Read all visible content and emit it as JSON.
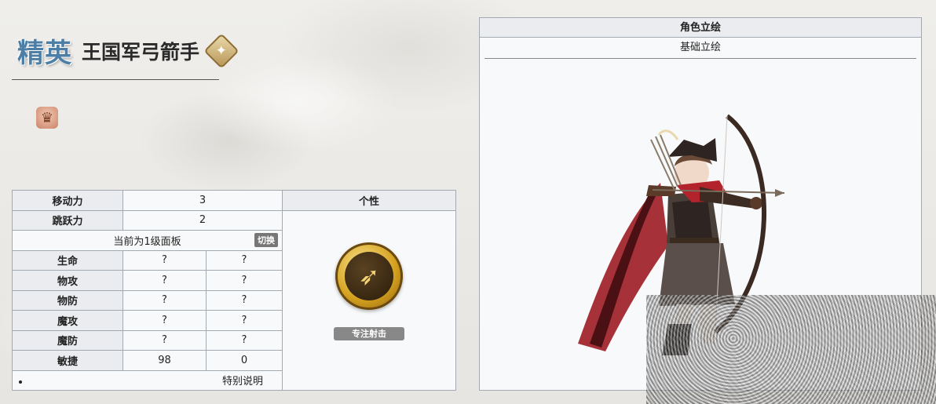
{
  "header": {
    "rank": "精英",
    "unit_name": "王国军弓箭手",
    "class_icon": "compass-emblem-icon",
    "crown_icon": "crown-icon"
  },
  "stats": {
    "move_label": "移动力",
    "move_value": "3",
    "jump_label": "跳跃力",
    "jump_value": "2",
    "trait_header": "个性",
    "panel_text": "当前为1级面板",
    "switch_label": "切换",
    "rows": [
      {
        "label": "生命",
        "a": "?",
        "b": "?"
      },
      {
        "label": "物攻",
        "a": "?",
        "b": "?"
      },
      {
        "label": "物防",
        "a": "?",
        "b": "?"
      },
      {
        "label": "魔攻",
        "a": "?",
        "b": "?"
      },
      {
        "label": "魔防",
        "a": "?",
        "b": "?"
      },
      {
        "label": "敏捷",
        "a": "98",
        "b": "0"
      }
    ],
    "trait_name": "专注射击",
    "trait_icon": "bow-arrow-icon",
    "note": "特别说明"
  },
  "portrait_panel": {
    "header": "角色立绘",
    "tab": "基础立绘"
  },
  "colors": {
    "table_header_bg": "#eaecf0",
    "table_border": "#a2a9b1",
    "rank_blue": "#4d7fa6",
    "cloak_red": "#9c1b22"
  }
}
